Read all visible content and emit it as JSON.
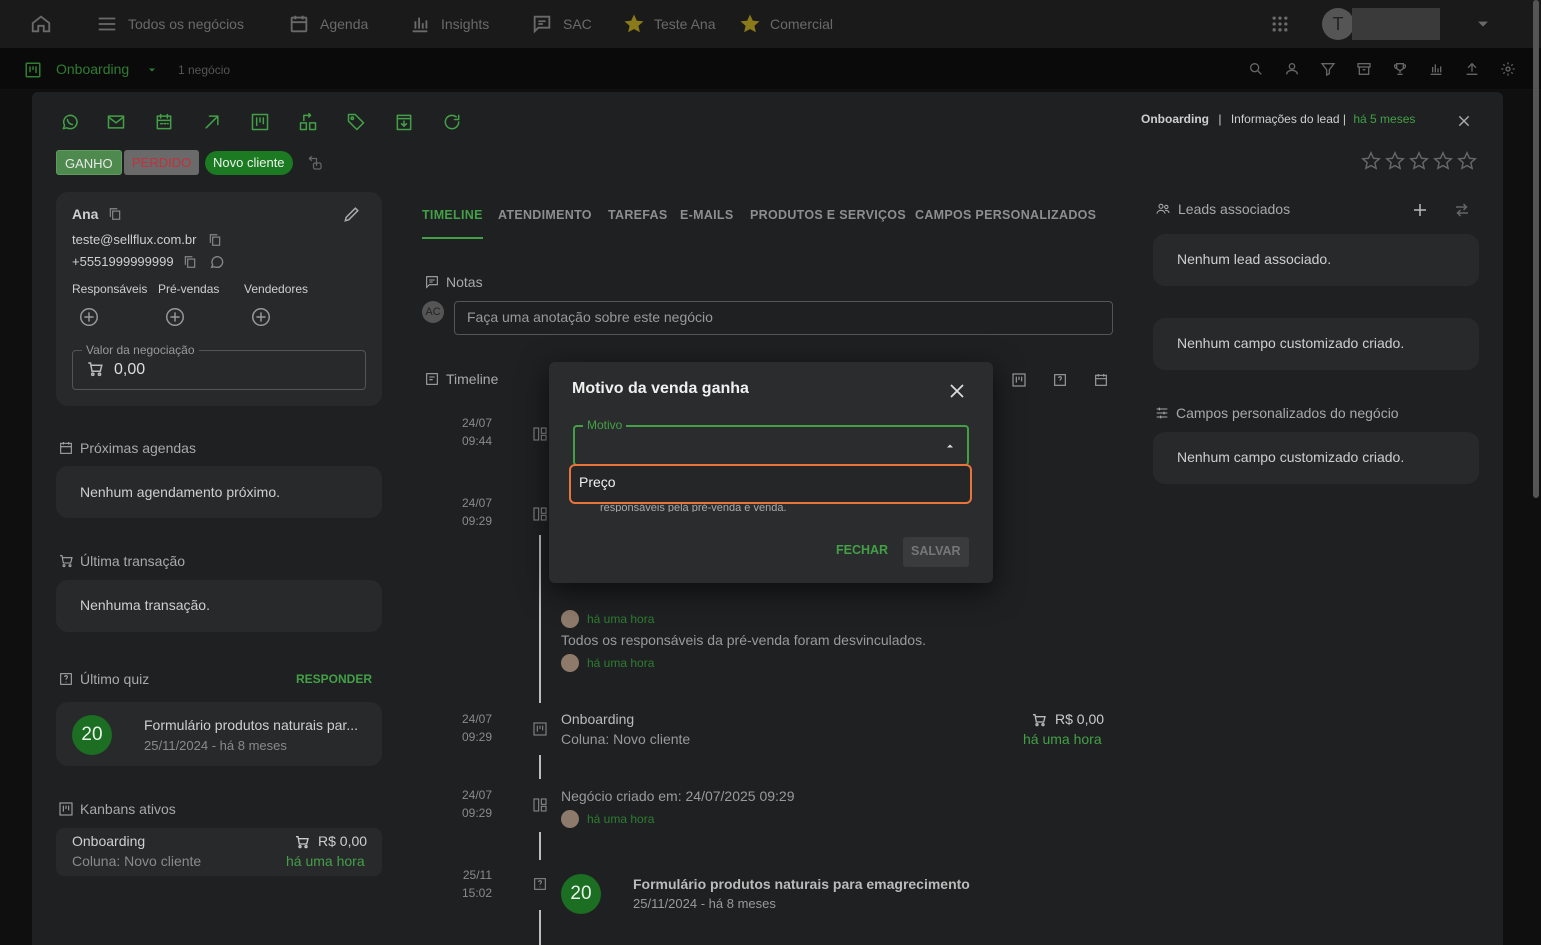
{
  "topbar": {
    "all_deals": "Todos os negócios",
    "agenda": "Agenda",
    "insights": "Insights",
    "sac": "SAC",
    "fav1": "Teste Ana",
    "fav2": "Comercial",
    "avatar_letter": "T"
  },
  "subbar": {
    "board": "Onboarding",
    "count": "1 negócio"
  },
  "deal": {
    "header_board": "Onboarding",
    "header_info": "Informações do lead |",
    "header_time": "há 5 meses",
    "separator": "|",
    "btn_won": "GANHO",
    "btn_lost": "PERDIDO",
    "column_badge": "Novo cliente"
  },
  "contact": {
    "name": "Ana",
    "email": "teste@sellflux.com.br",
    "phone": "+5551999999999",
    "responsaveis": "Responsáveis",
    "pre_vendas": "Pré-vendas",
    "vendedores": "Vendedores",
    "value_label": "Valor da negociação",
    "value": "0,00"
  },
  "left": {
    "agendas_title": "Próximas agendas",
    "agendas_empty": "Nenhum agendamento próximo.",
    "transaction_title": "Última transação",
    "transaction_empty": "Nenhuma transação.",
    "quiz_title": "Último quiz",
    "quiz_action": "RESPONDER",
    "quiz_score": "20",
    "quiz_name": "Formulário produtos naturais par...",
    "quiz_date": "25/11/2024 - há 8 meses",
    "kanbans_title": "Kanbans ativos",
    "kanban_name": "Onboarding",
    "kanban_value": "R$ 0,00",
    "kanban_column": "Coluna: Novo cliente",
    "kanban_time": "há uma hora"
  },
  "tabs": [
    "TIMELINE",
    "ATENDIMENTO",
    "TAREFAS",
    "E-MAILS",
    "PRODUTOS E SERVIÇOS",
    "CAMPOS PERSONALIZADOS"
  ],
  "notes": {
    "title": "Notas",
    "avatar": "AC",
    "placeholder": "Faça uma anotação sobre este negócio"
  },
  "timeline": {
    "title": "Timeline",
    "items": [
      {
        "date": "24/07",
        "time": "09:44"
      },
      {
        "date": "24/07",
        "time": "09:29"
      },
      {
        "date": "24/07",
        "time": "09:29"
      },
      {
        "date": "24/07",
        "time": "09:29"
      },
      {
        "date": "25/11",
        "time": "15:02"
      }
    ],
    "time_ago1": "há uma hora",
    "unlinked_text": "Todos os responsáveis da pré-venda foram desvinculados.",
    "time_ago2": "há uma hora",
    "onboarding_title": "Onboarding",
    "onboarding_column": "Coluna: Novo cliente",
    "onboarding_value": "R$ 0,00",
    "onboarding_time": "há uma hora",
    "created_text": "Negócio criado em: 24/07/2025 09:29",
    "created_time": "há uma hora",
    "quiz_score": "20",
    "quiz_title": "Formulário produtos naturais para emagrecimento",
    "quiz_date": "25/11/2024 - há 8 meses"
  },
  "right": {
    "leads_title": "Leads associados",
    "leads_empty": "Nenhum lead associado.",
    "custom_empty1": "Nenhum campo customizado criado.",
    "custom_title": "Campos personalizados do negócio",
    "custom_empty2": "Nenhum campo customizado criado."
  },
  "modal": {
    "title": "Motivo da venda ganha",
    "field_label": "Motivo",
    "option": "Preço",
    "hidden_text": "responsáveis pela pré-venda e venda.",
    "btn_close": "FECHAR",
    "btn_save": "SALVAR"
  },
  "colors": {
    "accent": "#43a047",
    "won": "#4e8a4e",
    "lost": "#b0313d",
    "badge": "#1b7a22",
    "highlight": "#e8743b"
  }
}
